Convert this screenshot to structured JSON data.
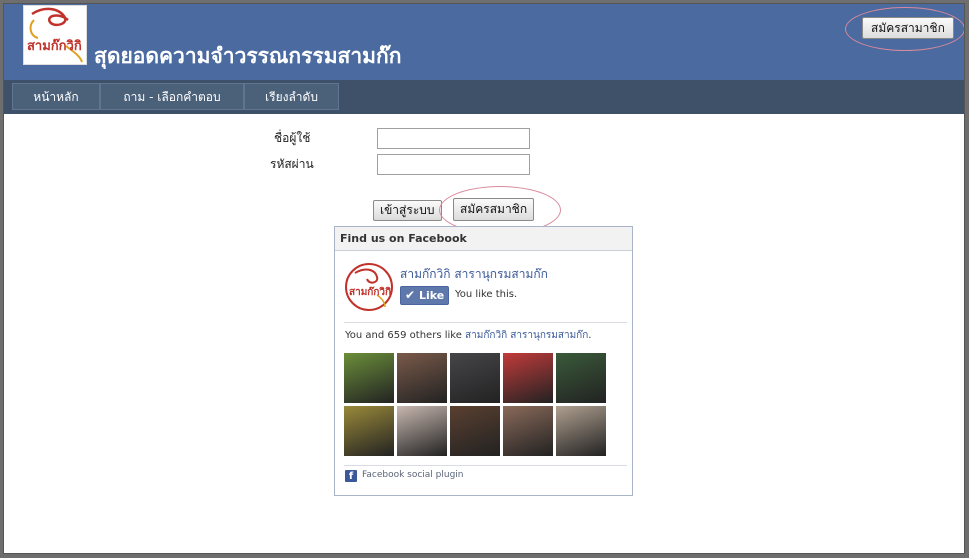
{
  "header": {
    "logo_text": "สามก๊กวิกิ",
    "site_title": "สุดยอดความจำวรรณกรรมสามก๊ก",
    "register_button": "สมัครสามาชิก"
  },
  "nav": {
    "items": [
      {
        "label": "หน้าหลัก"
      },
      {
        "label": "ถาม - เลือกคำตอบ"
      },
      {
        "label": "เรียงลำดับ"
      }
    ]
  },
  "login": {
    "username_label": "ชื่อผู้ใช้",
    "password_label": "รหัสผ่าน",
    "username_value": "",
    "password_value": "",
    "login_button": "เข้าสู่ระบบ",
    "register_button": "สมัครสมาชิก"
  },
  "facebook": {
    "heading": "Find us on Facebook",
    "page_name": "สามก๊กวิกิ สารานุกรมสามก๊ก",
    "like_button": "Like",
    "you_like": "You like this.",
    "others_prefix": "You and 659 others like ",
    "others_link": "สามก๊กวิกิ สารานุกรมสามก๊ก",
    "others_suffix": ".",
    "plugin_label": "Facebook social plugin",
    "avatars": [
      {
        "color": "#6b8f3a"
      },
      {
        "color": "#7a5a4a"
      },
      {
        "color": "#46464a"
      },
      {
        "color": "#c23b3b"
      },
      {
        "color": "#3a5a3a"
      },
      {
        "color": "#9a8a3a"
      },
      {
        "color": "#c8b8b0"
      },
      {
        "color": "#5a4030"
      },
      {
        "color": "#8a6a5a"
      },
      {
        "color": "#b0a090"
      }
    ]
  },
  "colors": {
    "header_bg": "#4a6aa0",
    "nav_bg": "#3e5169",
    "highlight_ring": "#d98a9a",
    "facebook_blue": "#3b5998"
  }
}
